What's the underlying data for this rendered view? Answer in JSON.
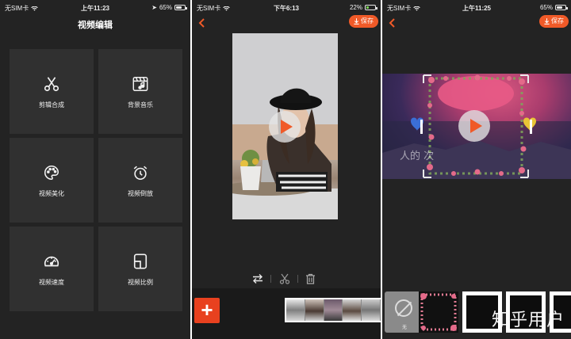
{
  "screen1": {
    "status": {
      "carrier": "无SIM卡",
      "time": "上午11:23",
      "battery": "65%"
    },
    "title": "视频编辑",
    "tiles": [
      {
        "label": "剪辑合成",
        "icon": "scissors-icon"
      },
      {
        "label": "背景音乐",
        "icon": "music-clapper-icon"
      },
      {
        "label": "视频美化",
        "icon": "palette-icon"
      },
      {
        "label": "视频倒放",
        "icon": "alarm-clock-icon"
      },
      {
        "label": "视频速度",
        "icon": "speedometer-icon"
      },
      {
        "label": "视频比例",
        "icon": "aspect-ratio-icon"
      }
    ]
  },
  "screen2": {
    "status": {
      "carrier": "无SIM卡",
      "time": "下午6:13",
      "battery": "22%"
    },
    "save_label": "保存",
    "add_label": "+"
  },
  "screen3": {
    "status": {
      "carrier": "无SIM卡",
      "time": "上午11:25",
      "battery": "65%"
    },
    "save_label": "保存",
    "video_text": "人的 次",
    "none_label": "无",
    "watermark": "知乎用户"
  },
  "colors": {
    "accent": "#f05a28",
    "add": "#e8411f",
    "bg": "#232323",
    "tile": "#303030"
  }
}
